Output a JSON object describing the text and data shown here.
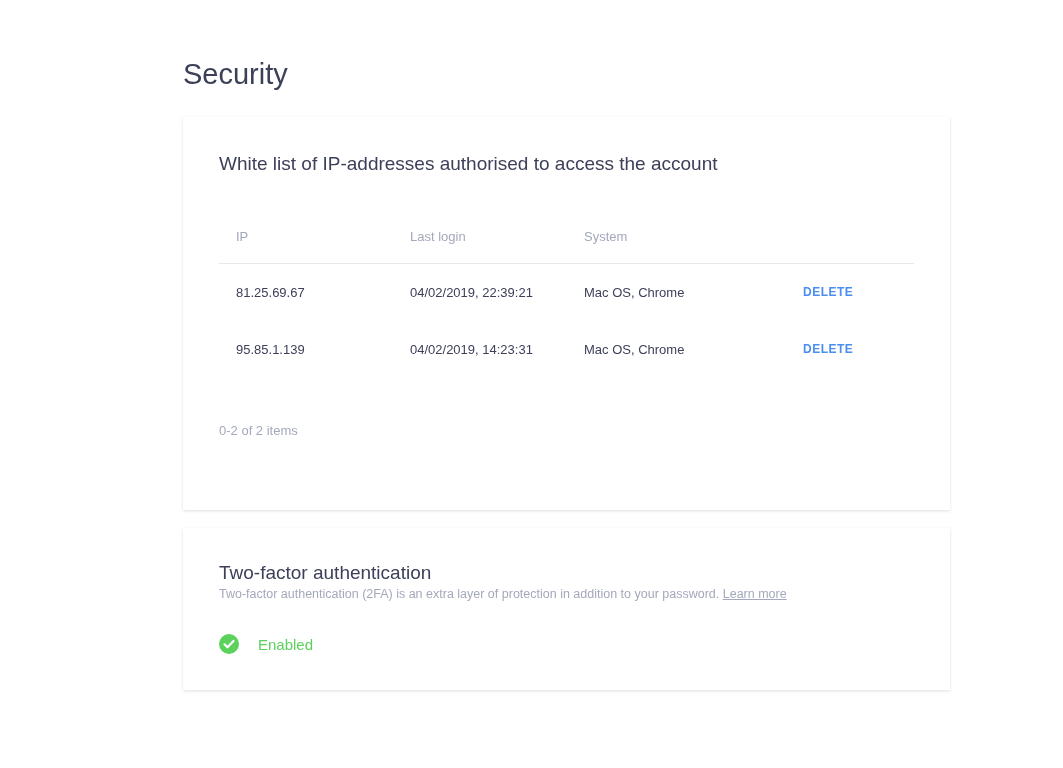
{
  "page_title": "Security",
  "whitelist": {
    "title": "White list of IP-addresses authorised to access the account",
    "columns": [
      "IP",
      "Last login",
      "System"
    ],
    "rows": [
      {
        "ip": "81.25.69.67",
        "last_login": "04/02/2019, 22:39:21",
        "system": "Mac OS, Chrome",
        "action": "DELETE"
      },
      {
        "ip": "95.85.1.139",
        "last_login": "04/02/2019, 14:23:31",
        "system": "Mac OS, Chrome",
        "action": "DELETE"
      }
    ],
    "pagination": "0-2 of 2 items"
  },
  "two_factor": {
    "title": "Two-factor authentication",
    "description": "Two-factor authentication (2FA) is an extra layer of protection in addition to your password.",
    "link": "Learn more",
    "enabled": true,
    "status": "Enabled"
  }
}
